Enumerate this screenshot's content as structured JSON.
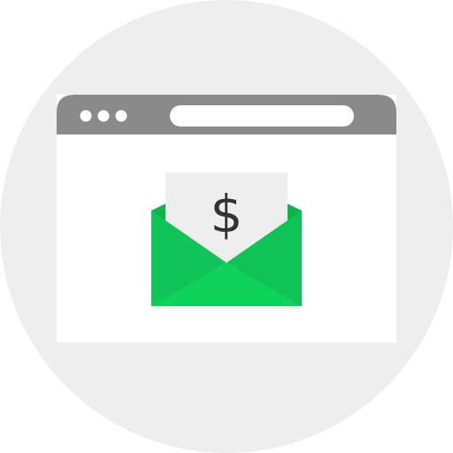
{
  "colors": {
    "backdrop_circle": "#eeeeee",
    "browser_titlebar": "#8a8a8a",
    "browser_dots": "#ffffff",
    "address_bar": "#ffffff",
    "browser_body": "#ffffff",
    "letter_paper": "#eeeeee",
    "envelope_back": "#0cb54a",
    "envelope_bottom": "#0dd35b",
    "envelope_left": "#11c45a",
    "envelope_right": "#10c356"
  },
  "icons": {
    "window_dots": "three-dots-icon",
    "currency": "dollar-sign-icon",
    "envelope": "open-envelope-icon"
  },
  "letter": {
    "symbol": "$"
  }
}
